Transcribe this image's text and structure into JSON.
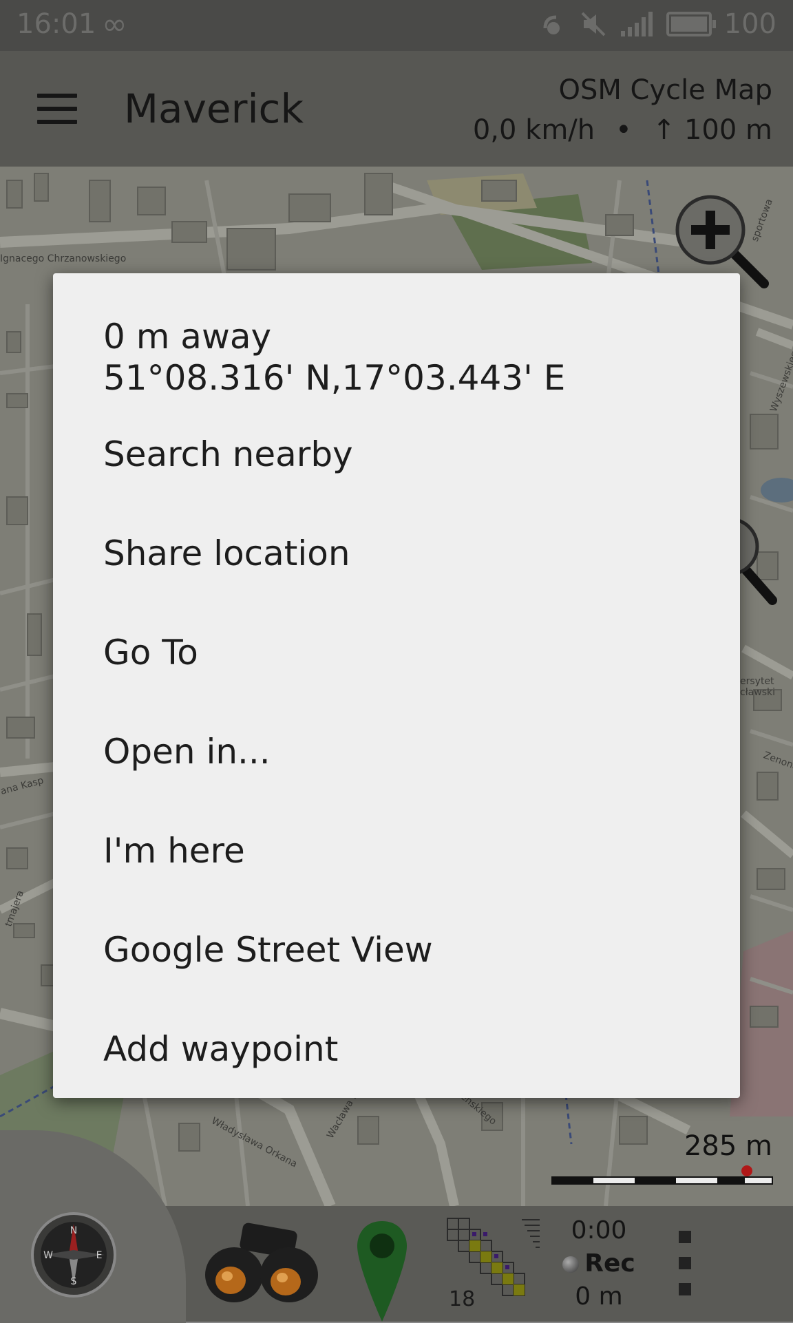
{
  "status_bar": {
    "time": "16:01",
    "battery_level": "100",
    "icons": [
      "infinity-icon",
      "sync-icon",
      "mute-icon",
      "signal-icon",
      "battery-icon"
    ]
  },
  "app_bar": {
    "title": "Maverick",
    "map_name": "OSM Cycle Map",
    "speed": "0,0 km/h",
    "separator": "•",
    "altitude": "↑ 100 m"
  },
  "map": {
    "labels": [
      "Ignacego Chrzanowskiego",
      "sportowa",
      "Wyszewskiego",
      "ersytet cławski",
      "Zenona",
      "ana Kasp",
      "tmajera",
      "Władysława Orkana",
      "Wacława B",
      "lenskiego"
    ],
    "scale_label": "285 m",
    "colors": {
      "base": "#7e7e76",
      "road": "#9a9a92",
      "building": "#6e6e67",
      "park": "#4a6e3a"
    }
  },
  "dialog": {
    "distance": "0 m away",
    "coordinates": "51°08.316' N,17°03.443' E",
    "items": [
      {
        "label": "Search nearby"
      },
      {
        "label": "Share location"
      },
      {
        "label": "Go To"
      },
      {
        "label": "Open in..."
      },
      {
        "label": "I'm here"
      },
      {
        "label": "Google Street View"
      },
      {
        "label": "Add waypoint"
      }
    ]
  },
  "bottom_bar": {
    "zoom_level": "18",
    "track_time": "0:00",
    "rec_label": "Rec",
    "track_distance": "0 m",
    "icons": [
      "compass-icon",
      "binoculars-icon",
      "map-pin-icon",
      "map-tiles-icon",
      "overflow-menu-icon"
    ]
  }
}
